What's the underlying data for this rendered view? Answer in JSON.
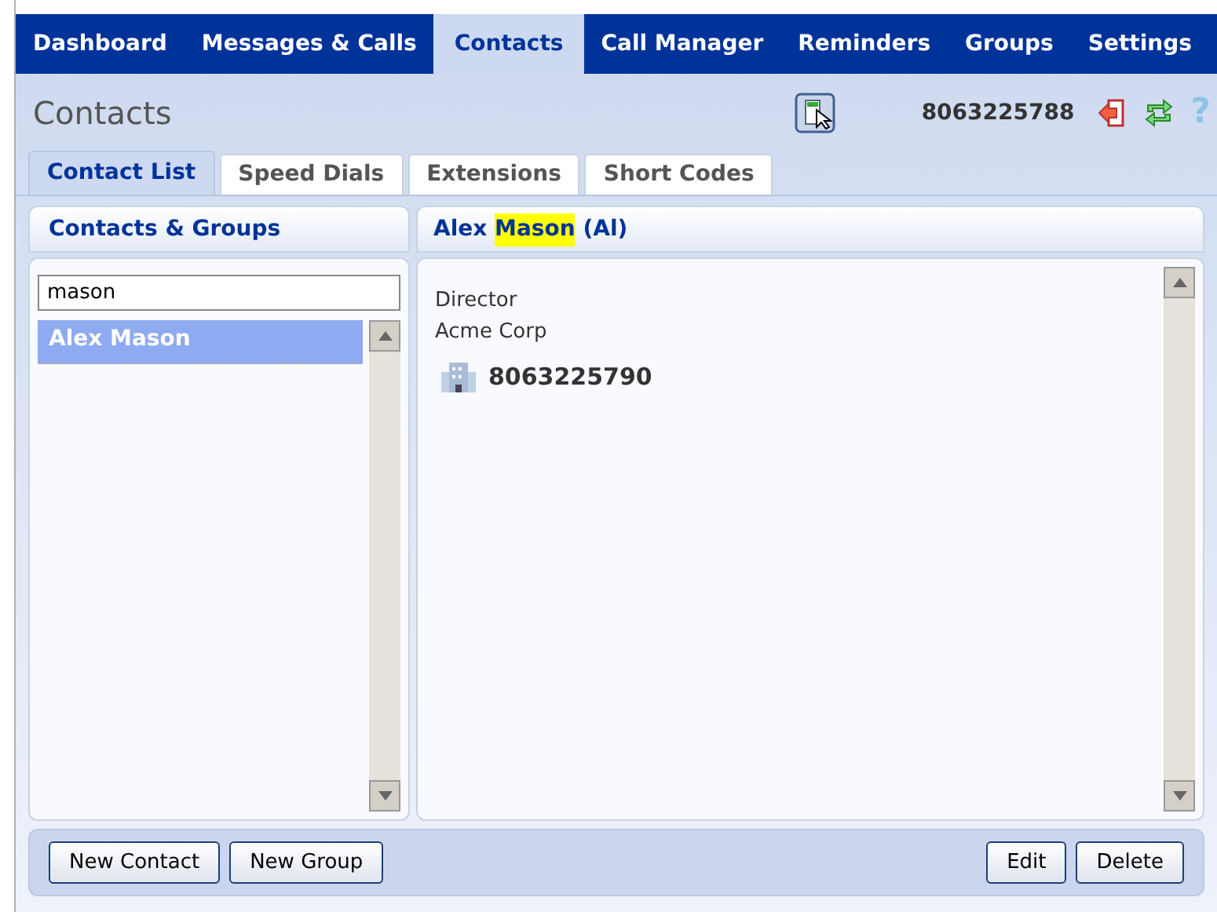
{
  "nav_tabs": [
    {
      "label": "Dashboard",
      "selected": false
    },
    {
      "label": "Messages & Calls",
      "selected": false
    },
    {
      "label": "Contacts",
      "selected": true
    },
    {
      "label": "Call Manager",
      "selected": false
    },
    {
      "label": "Reminders",
      "selected": false
    },
    {
      "label": "Groups",
      "selected": false
    },
    {
      "label": "Settings",
      "selected": false
    }
  ],
  "page_title": "Contacts",
  "phone_number": "8063225788",
  "help_icon": "?",
  "sub_tabs": [
    {
      "label": "Contact List",
      "selected": true
    },
    {
      "label": "Speed Dials",
      "selected": false
    },
    {
      "label": "Extensions",
      "selected": false
    },
    {
      "label": "Short Codes",
      "selected": false
    }
  ],
  "left_panel": {
    "title": "Contacts & Groups",
    "search": {
      "value": "mason"
    },
    "items": [
      {
        "label": "Alex Mason",
        "selected": true
      }
    ]
  },
  "right_panel": {
    "title_parts": [
      {
        "text": "Alex ",
        "highlighted": false
      },
      {
        "text": "Mason",
        "highlighted": true
      },
      {
        "text": " (Al)",
        "highlighted": false
      }
    ],
    "job_title": "Director",
    "company": "Acme Corp",
    "work_phone": "8063225790"
  },
  "footer_buttons_left": [
    "New Contact",
    "New Group"
  ],
  "footer_buttons_right": [
    "Edit",
    "Delete"
  ]
}
